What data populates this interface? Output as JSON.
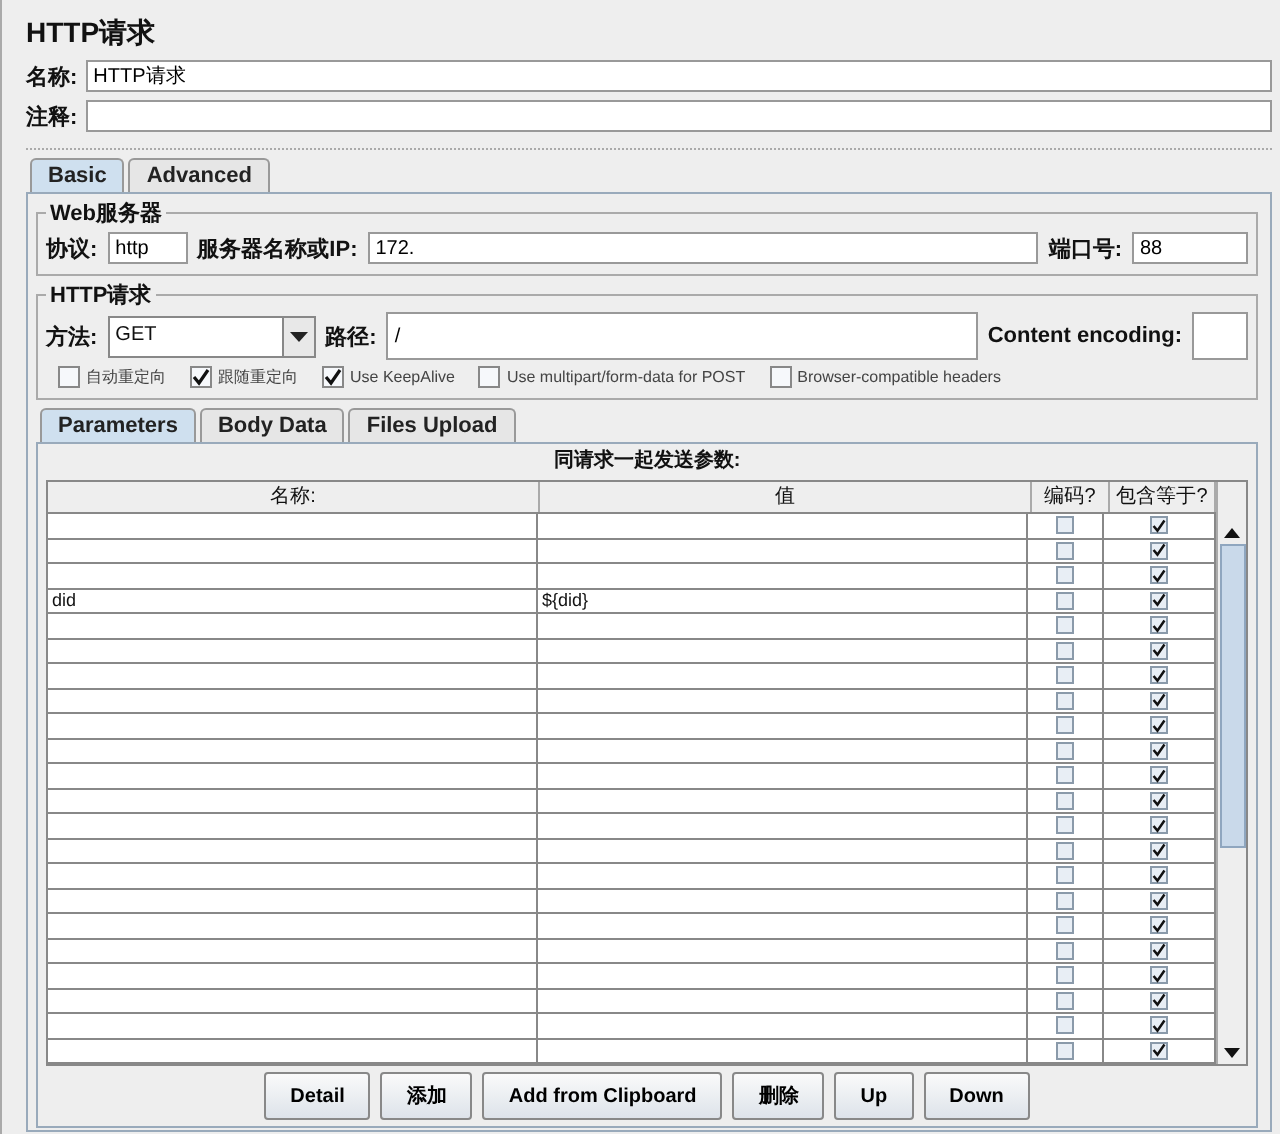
{
  "title": "HTTP请求",
  "name_field": {
    "label": "名称:",
    "value": "HTTP请求"
  },
  "comment_field": {
    "label": "注释:"
  },
  "tabs": [
    {
      "label": "Basic",
      "selected": true
    },
    {
      "label": "Advanced",
      "selected": false
    }
  ],
  "web_server": {
    "legend": "Web服务器",
    "protocol_label": "协议:",
    "protocol": "http",
    "server_label": "服务器名称或IP:",
    "server": "172.",
    "port_label": "端口号:",
    "port": "88"
  },
  "http_request": {
    "legend": "HTTP请求",
    "method_label": "方法:",
    "method": "GET",
    "path_label": "路径:",
    "path": "/",
    "encoding_label": "Content encoding:"
  },
  "options": [
    {
      "label": "自动重定向",
      "checked": false
    },
    {
      "label": "跟随重定向",
      "checked": true
    },
    {
      "label": "Use KeepAlive",
      "checked": true
    },
    {
      "label": "Use multipart/form-data for POST",
      "checked": false
    },
    {
      "label": "Browser-compatible headers",
      "checked": false
    }
  ],
  "param_tabs": [
    {
      "label": "Parameters",
      "selected": true
    },
    {
      "label": "Body Data",
      "selected": false
    },
    {
      "label": "Files Upload",
      "selected": false
    }
  ],
  "table": {
    "caption": "同请求一起发送参数:",
    "columns": [
      "名称:",
      "值",
      "编码?",
      "包含等于?"
    ],
    "rows": [
      {
        "encode": false,
        "include_equals": true
      },
      {
        "encode": false,
        "include_equals": true
      },
      {
        "encode": false,
        "include_equals": true
      },
      {
        "name": "did",
        "value": "${did}",
        "encode": false,
        "include_equals": true
      },
      {
        "encode": false,
        "include_equals": true
      },
      {
        "encode": false,
        "include_equals": true
      },
      {
        "encode": false,
        "include_equals": true
      },
      {
        "encode": false,
        "include_equals": true
      },
      {
        "encode": false,
        "include_equals": true
      },
      {
        "encode": false,
        "include_equals": true
      },
      {
        "encode": false,
        "include_equals": true
      },
      {
        "encode": false,
        "include_equals": true
      },
      {
        "encode": false,
        "include_equals": true
      },
      {
        "encode": false,
        "include_equals": true
      },
      {
        "encode": false,
        "include_equals": true
      },
      {
        "encode": false,
        "include_equals": true
      },
      {
        "encode": false,
        "include_equals": true
      },
      {
        "encode": false,
        "include_equals": true
      },
      {
        "encode": false,
        "include_equals": true
      },
      {
        "encode": false,
        "include_equals": true
      },
      {
        "encode": false,
        "include_equals": true
      },
      {
        "encode": false,
        "include_equals": true
      }
    ]
  },
  "buttons": [
    "Detail",
    "添加",
    "Add from Clipboard",
    "删除",
    "Up",
    "Down"
  ]
}
